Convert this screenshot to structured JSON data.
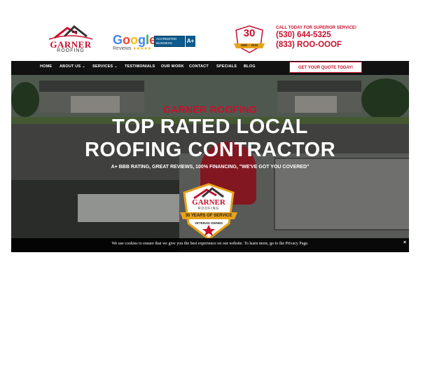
{
  "header": {
    "logo": {
      "word": "GARNER",
      "sub": "ROOFING"
    },
    "google": {
      "wordmark": "Google",
      "reviews": "Reviews",
      "stars": "★★★★★"
    },
    "bbb": {
      "line1": "ACCREDITED",
      "line2": "BUSINESS",
      "rating": "A+"
    },
    "anniversary": {
      "number": "30",
      "years": "1992 – 2022"
    },
    "cta": "CALL TODAY FOR SUPERIOR SERVICE!",
    "phone1": "(530) 644-5325",
    "phone2": "(833) ROO-OOOF"
  },
  "nav": {
    "items": [
      "HOME",
      "ABOUT US",
      "SERVICES",
      "TESTIMONIALS",
      "OUR WORK",
      "CONTACT",
      "SPECIALS",
      "BLOG"
    ],
    "quote_button": "GET YOUR QUOTE TODAY!"
  },
  "hero": {
    "tagline": "GARNER ROOFING",
    "headline1": "TOP RATED LOCAL",
    "headline2": "ROOFING CONTRACTOR",
    "subline": "A+ BBB RATING, GREAT REVIEWS, 100% FINANCING, \"WE'VE GOT YOU COVERED\"",
    "seal": {
      "brand": "GARNER",
      "brand_sub": "ROOFING",
      "ribbon": "30 YEARS OF SERVICE",
      "footer": "VETERAN OWNED"
    }
  },
  "cookie": {
    "text": "We use cookies to ensure that we give you the best experience on our website. To learn more, go to the Privacy Page.",
    "close": "×"
  },
  "colors": {
    "brand_red": "#c8102e",
    "nav_bg": "#111111",
    "bbb_blue": "#0d5a8c",
    "seal_gold": "#e8a21a"
  }
}
